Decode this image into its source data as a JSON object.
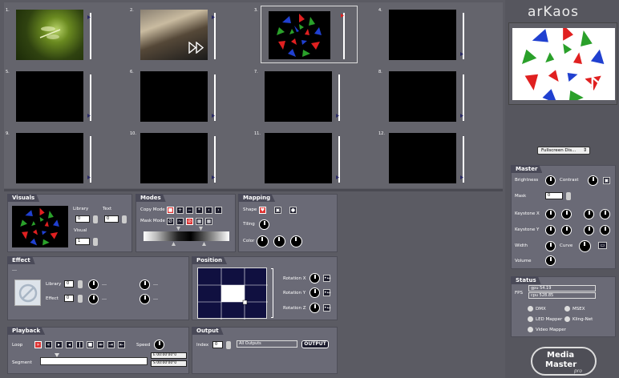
{
  "brand": "arKaos",
  "grid": {
    "cells": [
      {
        "num": "1."
      },
      {
        "num": "2."
      },
      {
        "num": "3."
      },
      {
        "num": "4."
      },
      {
        "num": "5."
      },
      {
        "num": "6."
      },
      {
        "num": "7."
      },
      {
        "num": "8."
      },
      {
        "num": "9."
      },
      {
        "num": "10."
      },
      {
        "num": "11."
      },
      {
        "num": "12."
      }
    ]
  },
  "preview": {
    "display_select": "Fullscreen Dis..."
  },
  "master": {
    "title": "Master",
    "brightness": "Brightness",
    "contrast": "Contrast",
    "mask": "Mask",
    "mask_value": "0",
    "keystone_x": "Keystone X",
    "keystone_y": "Keystone Y",
    "width": "Width",
    "curve": "Curve",
    "volume": "Volume"
  },
  "status": {
    "title": "Status",
    "fps": "FPS",
    "gpu_line1": "gpu 54.19",
    "gpu_line2": "cpu 528.85",
    "dmx": "DMX",
    "msex": "MSEX",
    "led_mapper": "LED Mapper",
    "kling_net": "Kling-Net",
    "video_mapper": "Video Mapper"
  },
  "logo": {
    "line1": "Media",
    "line2": "Master",
    "line3": "pro"
  },
  "visuals": {
    "title": "Visuals",
    "library": "Library",
    "text": "Text",
    "visual": "Visual",
    "library_value": "0",
    "text_value": "0",
    "visual_value": "1"
  },
  "modes": {
    "title": "Modes",
    "copy_mode": "Copy Mode",
    "mask_mode": "Mask Mode"
  },
  "mapping": {
    "title": "Mapping",
    "shape": "Shape",
    "tiling": "Tiling",
    "color": "Color"
  },
  "effect": {
    "title": "Effect",
    "dash": "---",
    "library": "Library",
    "effect": "Effect",
    "lib_value": "0",
    "eff_value": "0",
    "p1": "---",
    "p2": "---",
    "p3": "---",
    "p4": "---"
  },
  "position": {
    "title": "Position",
    "rot_x": "Rotation X",
    "rot_y": "Rotation Y",
    "rot_z": "Rotation Z"
  },
  "playback": {
    "title": "Playback",
    "loop": "Loop",
    "speed": "Speed",
    "segment": "Segment",
    "time_s": "S 00:00'00\"0",
    "time_e": "E 00:00'00\"0"
  },
  "output": {
    "title": "Output",
    "index": "Index",
    "index_value": "0",
    "select": "All Outputs",
    "button": "OUTPUT"
  },
  "colors": {
    "bg": "#5b5b63",
    "panel": "#6a6a76",
    "accent_red": "#d33333"
  }
}
